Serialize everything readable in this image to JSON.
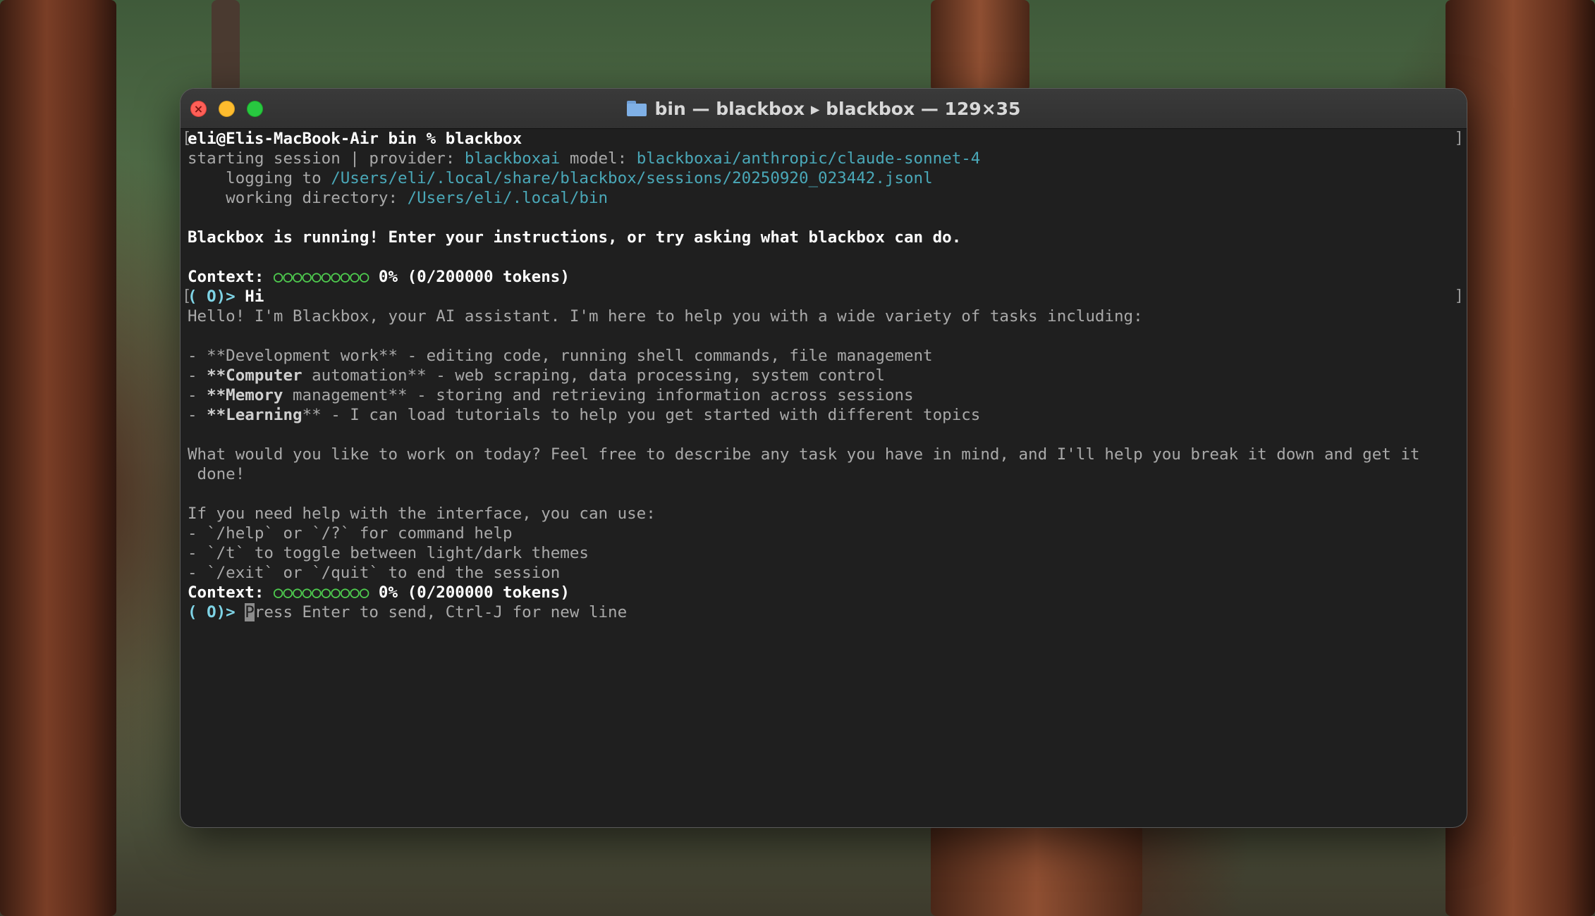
{
  "window": {
    "title": "bin — blackbox ▸ blackbox — 129×35"
  },
  "terminal": {
    "prompt_shell": "eli@Elis-MacBook-Air bin % blackbox",
    "session": {
      "label1": "starting session | provider: ",
      "provider": "blackboxai",
      "label2": " model: ",
      "model": "blackboxai/anthropic/claude-sonnet-4",
      "logging_label": "    logging to ",
      "logging_path": "/Users/eli/.local/share/blackbox/sessions/20250920_023442.jsonl",
      "workdir_label": "    working directory: ",
      "workdir_path": "/Users/eli/.local/bin"
    },
    "welcome": "Blackbox is running! Enter your instructions, or try asking what blackbox can do.",
    "context": {
      "label": "Context: ",
      "meter": "○○○○○○○○○○",
      "value": " 0% (0/200000 tokens)"
    },
    "prompt_symbol": "( O)> ",
    "user_message": "Hi",
    "reply": {
      "intro": "Hello! I'm Blackbox, your AI assistant. I'm here to help you with a wide variety of tasks including:",
      "b1_pre": "- ",
      "b1_text": "**Development work** - editing code, running shell commands, file management",
      "b2_pre": "- ",
      "b2_bold": "**Computer",
      "b2_rest": " automation** - web scraping, data processing, system control",
      "b3_pre": "- ",
      "b3_bold": "**Memory",
      "b3_rest": " management** - storing and retrieving information across sessions",
      "b4_pre": "- ",
      "b4_bold": "**Learning",
      "b4_rest": "** - I can load tutorials to help you get started with different topics",
      "question_l1": "What would you like to work on today? Feel free to describe any task you have in mind, and I'll help you break it down and get it",
      "question_l2": " done!",
      "help_intro": "If you need help with the interface, you can use:",
      "help1": "- `/help` or `/?` for command help",
      "help2": "- `/t` to toggle between light/dark themes",
      "help3": "- `/exit` or `/quit` to end the session"
    },
    "input_placeholder_first": "P",
    "input_placeholder_rest": "ress Enter to send, Ctrl-J for new line"
  },
  "colors": {
    "accent_cyan": "#4aa8b8",
    "prompt_cyan": "#7fd4e6",
    "meter_green": "#4fcc4f",
    "terminal_bg": "#1f1f1f"
  }
}
